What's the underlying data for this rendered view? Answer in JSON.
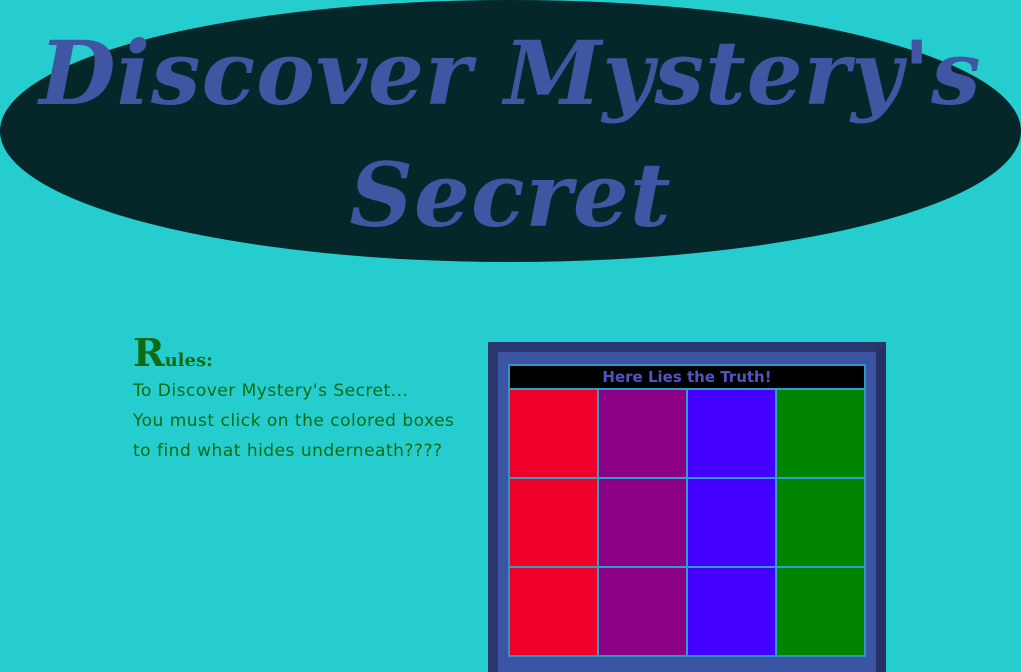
{
  "title": {
    "line1": "Discover Mystery's",
    "line2": "Secret"
  },
  "rules": {
    "heading_initial": "R",
    "heading_rest": "ules:",
    "lines": [
      "To Discover Mystery's Secret...",
      "You must click on the colored boxes",
      "to find what hides underneath????"
    ]
  },
  "board": {
    "header": "Here Lies the Truth!",
    "column_colors": [
      "#ef0029",
      "#8b0085",
      "#4400ff",
      "#018500"
    ],
    "rows": [
      [
        "#ef0029",
        "#8b0085",
        "#4400ff",
        "#018500"
      ],
      [
        "#ef0029",
        "#8b0085",
        "#4400ff",
        "#018500"
      ],
      [
        "#ef0029",
        "#8b0085",
        "#4400ff",
        "#018500"
      ]
    ]
  },
  "colors": {
    "background": "#26cdcf",
    "banner": "#06272a",
    "title_text": "#4156a3",
    "rules_text": "#0d6b12"
  }
}
